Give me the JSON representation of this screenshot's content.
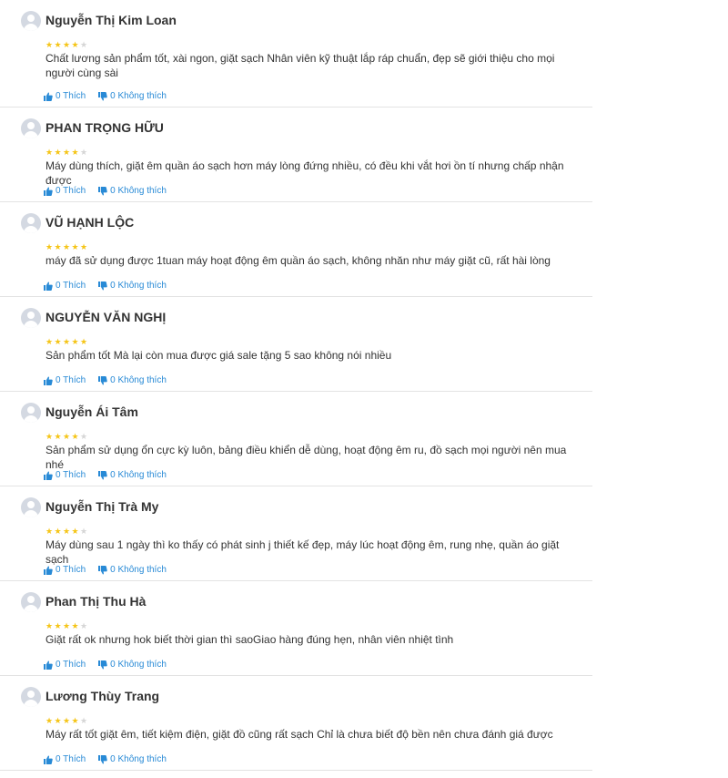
{
  "like_label": "Thích",
  "dislike_label": "Không thích",
  "colors": {
    "accent": "#288ad6",
    "star_on": "#f5c518",
    "star_off": "#d6d6d6",
    "divider": "#e3e3e3"
  },
  "reviews": [
    {
      "name": "Nguyễn Thị Kim Loan",
      "rating": 4,
      "content": "Chất lương sản phẩm tốt, xài ngon, giặt sạch Nhân viên kỹ thuật lắp ráp chuẩn, đẹp sẽ giới thiệu cho mọi người cùng sài",
      "likes": "0 Thích",
      "dislikes": "0 Không thích"
    },
    {
      "name": "PHAN TRỌNG HỮU",
      "rating": 4,
      "content": "Máy dùng thích, giặt êm quần áo sạch hơn máy lòng đứng nhiều, có đều khi vắt hơi ồn tí nhưng chấp nhận được",
      "likes": "0 Thích",
      "dislikes": "0 Không thích"
    },
    {
      "name": "VŨ HẠNH LỘC",
      "rating": 5,
      "content": "máy đã sử dụng được 1tuan máy hoạt động êm quần áo sạch, không nhăn như máy giặt cũ, rất hài lòng",
      "likes": "0 Thích",
      "dislikes": "0 Không thích"
    },
    {
      "name": "NGUYỄN VĂN NGHỊ",
      "rating": 5,
      "content": "Sản phẩm tốt Mà lại còn mua được giá sale tặng 5 sao không nói nhiều",
      "likes": "0 Thích",
      "dislikes": "0 Không thích"
    },
    {
      "name": "Nguyễn Ái Tâm",
      "rating": 4,
      "content": "Sản phẩm sử dụng ổn cực kỳ luôn, bảng điều khiển dễ dùng, hoạt động êm ru, đồ sạch mọi người nên mua nhé",
      "likes": "0 Thích",
      "dislikes": "0 Không thích"
    },
    {
      "name": "Nguyễn Thị Trà My",
      "rating": 4,
      "content": "Máy dùng sau 1 ngày thì ko thấy có phát sinh j thiết kế đẹp, máy lúc hoạt động êm, rung nhẹ, quần áo giặt sạch",
      "likes": "0 Thích",
      "dislikes": "0 Không thích"
    },
    {
      "name": "Phan Thị Thu Hà",
      "rating": 4,
      "content": "Giặt rất ok nhưng hok biết thời gian thì saoGiao hàng đúng hẹn, nhân viên nhiệt tình",
      "likes": "0 Thích",
      "dislikes": "0 Không thích"
    },
    {
      "name": "Lương Thùy Trang",
      "rating": 4,
      "content": "Máy rất tốt giặt êm, tiết kiệm điện, giặt đồ cũng rất sạch Chỉ là chưa biết độ bền nên chưa đánh giá được",
      "likes": "0 Thích",
      "dislikes": "0 Không thích"
    }
  ]
}
